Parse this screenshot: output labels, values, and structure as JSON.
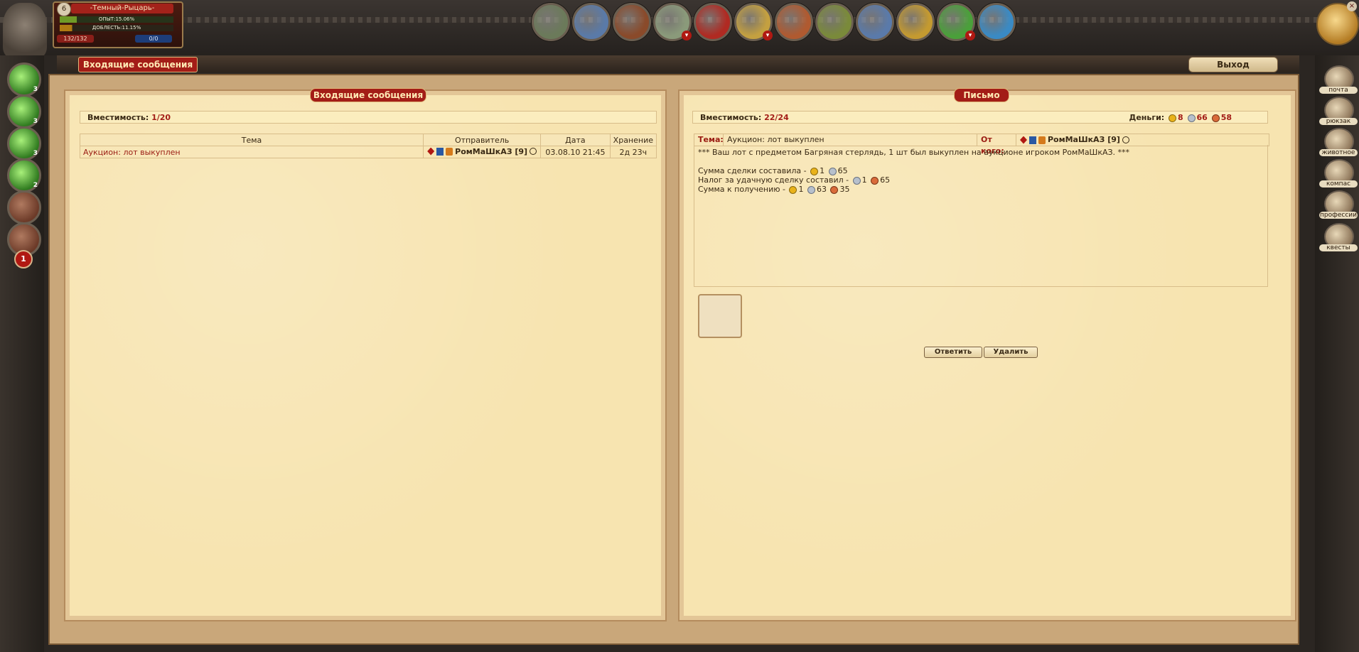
{
  "character": {
    "level": "6",
    "name": "-Темный-Рыцарь-",
    "exp_label": "ОПЫТ:15.06%",
    "valor_label": "ДОБЛЕСТЬ:11.15%",
    "hp": "132/132",
    "mp": "0/0"
  },
  "top_icons": [
    {
      "name": "clan-shield-icon",
      "color": "#6b7a5a",
      "arrow": false
    },
    {
      "name": "castle-icon",
      "color": "#5a7aa8",
      "arrow": false
    },
    {
      "name": "bear-icon",
      "color": "#8a4a2a",
      "arrow": false
    },
    {
      "name": "knight-icon",
      "color": "#8a9a7a",
      "arrow": true
    },
    {
      "name": "battle-icon",
      "color": "#b02a22",
      "arrow": false
    },
    {
      "name": "world-map-icon",
      "color": "#c4a040",
      "arrow": true
    },
    {
      "name": "quest-figure-icon",
      "color": "#b05a30",
      "arrow": false
    },
    {
      "name": "hammer-icon",
      "color": "#7a8a3a",
      "arrow": false
    },
    {
      "name": "flags-icon",
      "color": "#5a7aaa",
      "arrow": false
    },
    {
      "name": "coins-icon",
      "color": "#c49a30",
      "arrow": false
    },
    {
      "name": "help-icon",
      "color": "#4aa03a",
      "arrow": true
    },
    {
      "name": "chat-icon",
      "color": "#3a8ac4",
      "arrow": false
    }
  ],
  "header": {
    "title": "Входящие сообщения",
    "exit_label": "Выход"
  },
  "left_slots": [
    {
      "type": "green",
      "count": "3"
    },
    {
      "type": "green",
      "count": "3"
    },
    {
      "type": "green",
      "count": "3"
    },
    {
      "type": "green",
      "count": "2"
    },
    {
      "type": "empty",
      "count": ""
    },
    {
      "type": "empty",
      "count": ""
    }
  ],
  "page_badge": "1",
  "right_menu": [
    {
      "label": "почта",
      "icon": "mail-icon"
    },
    {
      "label": "рюкзак",
      "icon": "backpack-icon"
    },
    {
      "label": "животное",
      "icon": "pet-icon"
    },
    {
      "label": "компас",
      "icon": "compass-icon"
    },
    {
      "label": "профессии",
      "icon": "professions-icon"
    },
    {
      "label": "квесты",
      "icon": "quests-icon"
    }
  ],
  "inbox": {
    "panel_title": "Входящие сообщения",
    "capacity_label": "Вместимость:",
    "capacity_value": "1/20",
    "columns": [
      "Тема",
      "Отправитель",
      "Дата",
      "Хранение"
    ],
    "rows": [
      {
        "subject": "Аукцион: лот выкуплен",
        "sender": "РомМаШкАЗ [9]",
        "date": "03.08.10 21:45",
        "storage": "2д 23ч"
      }
    ]
  },
  "letter": {
    "panel_title": "Письмо",
    "capacity_label": "Вместимость:",
    "capacity_value": "22/24",
    "money_label": "Деньги:",
    "money": {
      "gold": "8",
      "silver": "66",
      "bronze": "58"
    },
    "subject_label": "Тема:",
    "subject": "Аукцион: лот выкуплен",
    "from_label": "От кого:",
    "from": "РомМаШкАЗ [9]",
    "body_line1": "*** Ваш лот с предметом Багряная стерлядь, 1 шт был выкуплен на аукционе игроком РомМаШкАЗ. ***",
    "sum_label": "Сумма сделки составила -",
    "sum": {
      "gold": "1",
      "silver": "65"
    },
    "tax_label": "Налог за удачную сделку составил -",
    "tax": {
      "silver": "1",
      "bronze": "65"
    },
    "receive_label": "Сумма к получению -",
    "receive": {
      "gold": "1",
      "silver": "63",
      "bronze": "35"
    },
    "reply_label": "Ответить",
    "delete_label": "Удалить"
  }
}
